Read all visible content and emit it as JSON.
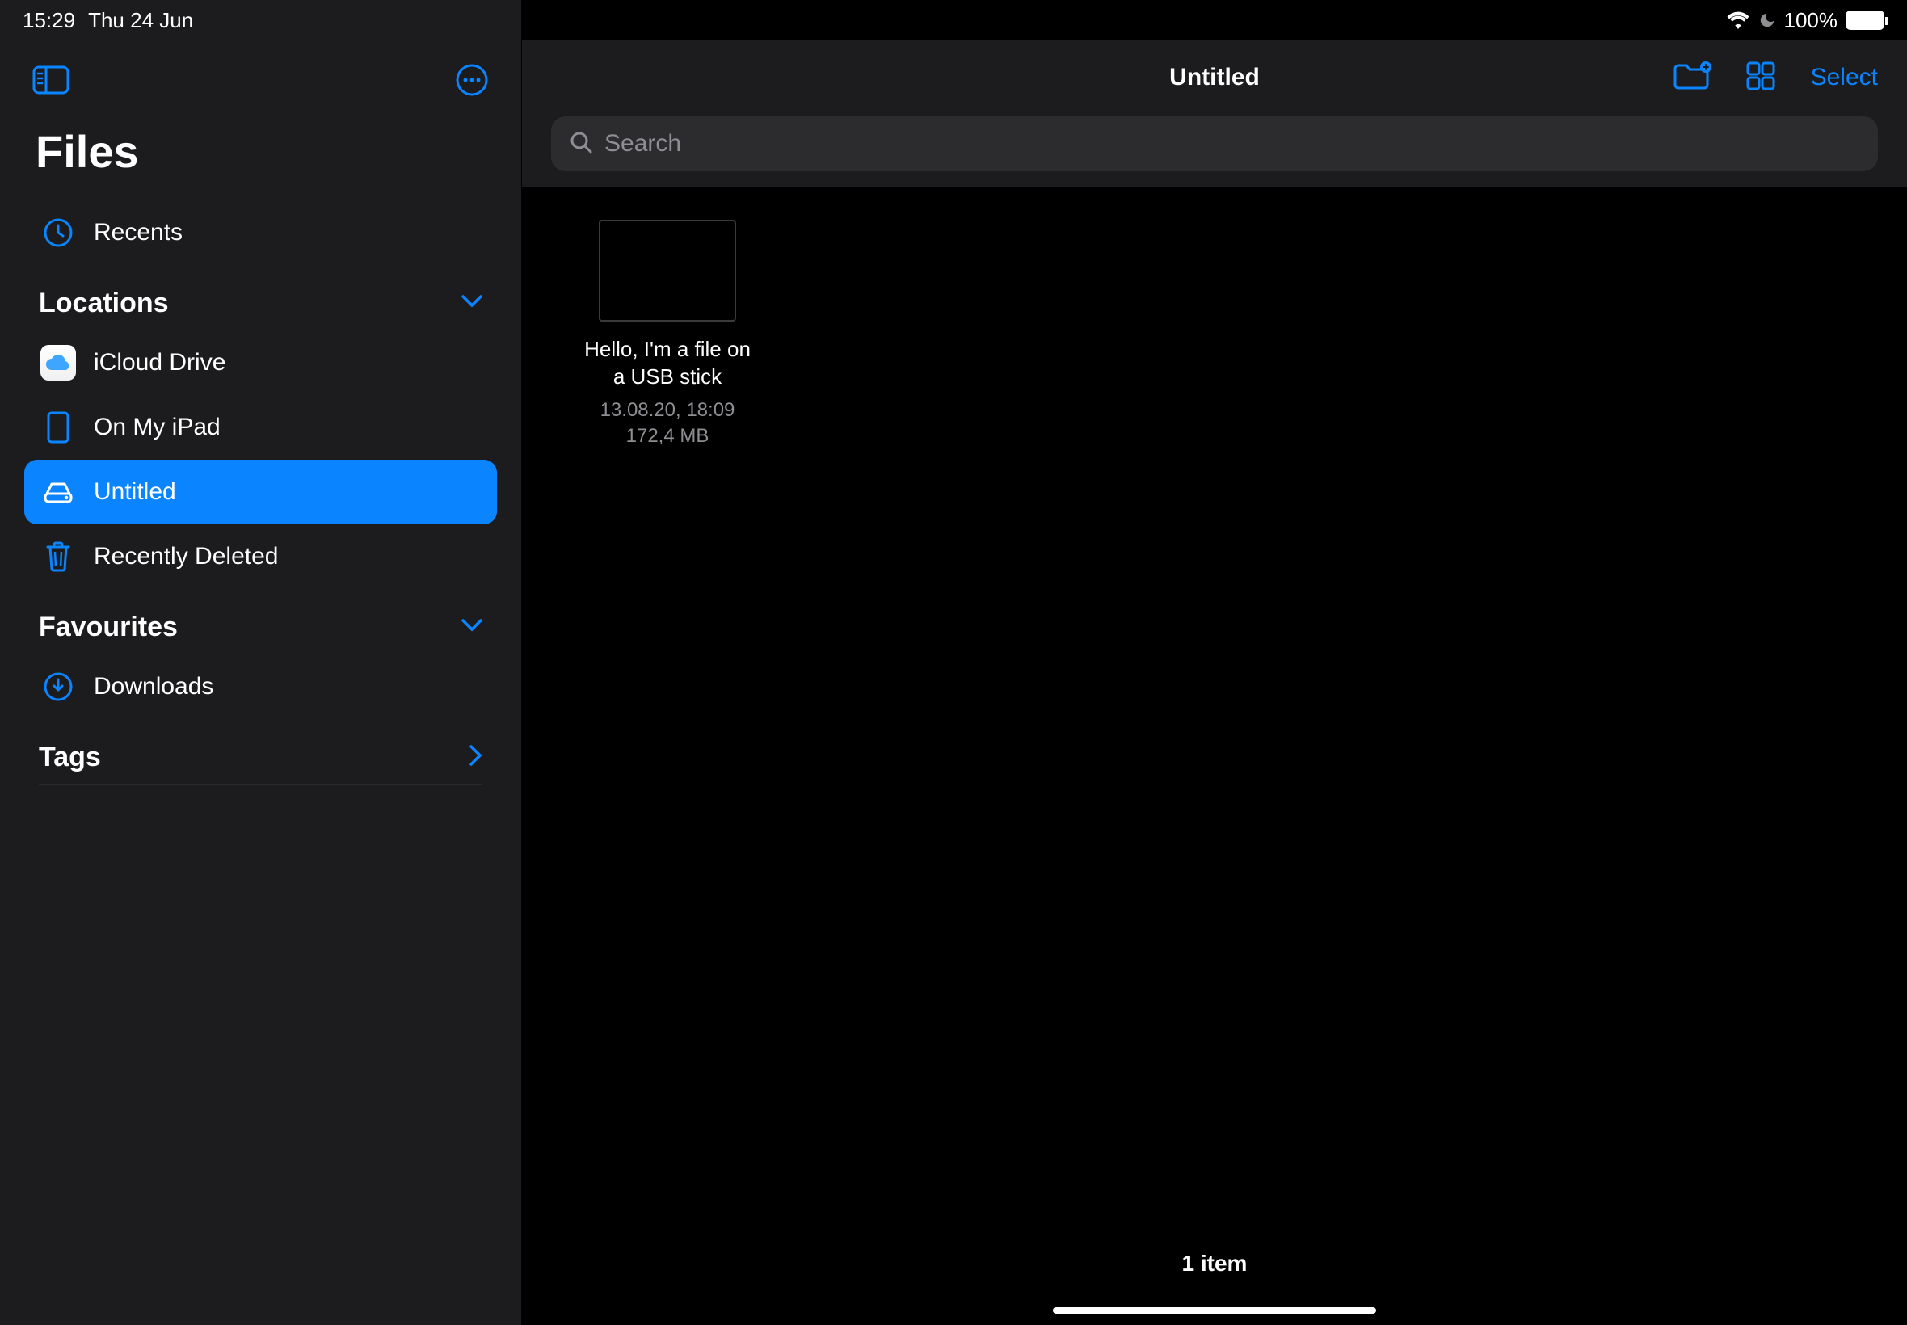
{
  "status": {
    "time": "15:29",
    "date": "Thu 24 Jun",
    "battery_pct": "100%"
  },
  "sidebar": {
    "app_title": "Files",
    "recents_label": "Recents",
    "locations": {
      "header": "Locations",
      "items": {
        "icloud": "iCloud Drive",
        "onmyipad": "On My iPad",
        "untitled": "Untitled",
        "recently_deleted": "Recently Deleted"
      }
    },
    "favourites": {
      "header": "Favourites",
      "items": {
        "downloads": "Downloads"
      }
    },
    "tags_header": "Tags"
  },
  "header": {
    "title": "Untitled",
    "select_label": "Select"
  },
  "search": {
    "placeholder": "Search"
  },
  "files": [
    {
      "name": "Hello, I'm a file on a USB stick",
      "date": "13.08.20, 18:09",
      "size": "172,4 MB"
    }
  ],
  "footer": {
    "count": "1 item"
  }
}
